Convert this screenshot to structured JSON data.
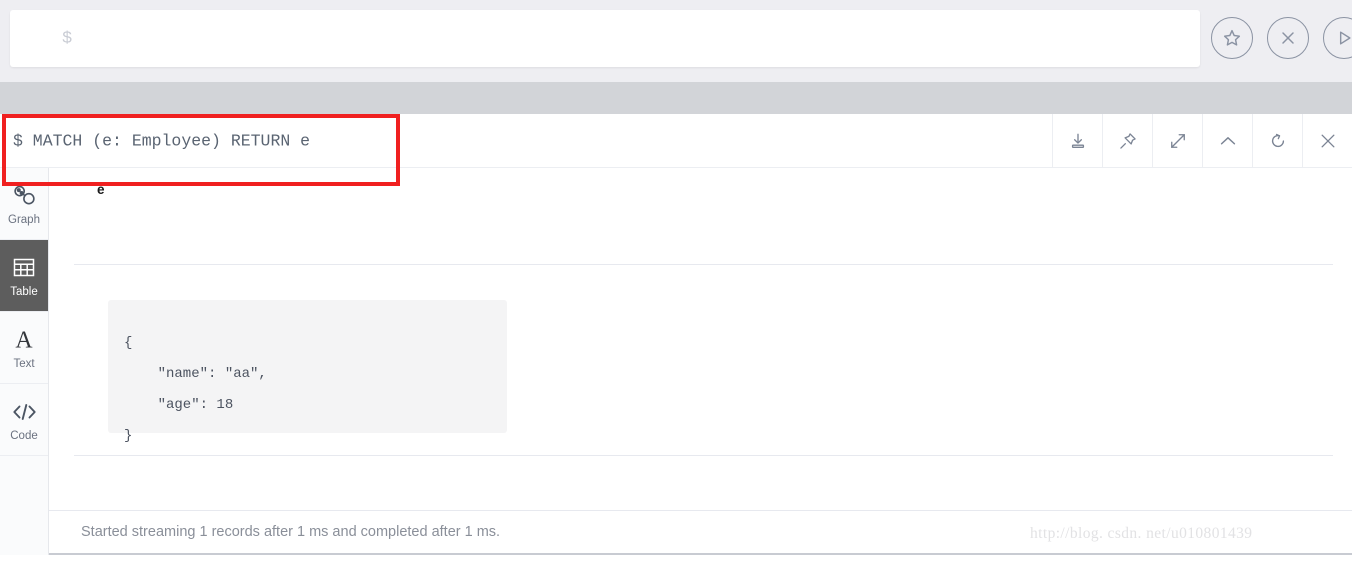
{
  "editor": {
    "placeholder": "$",
    "value": "",
    "buttons": [
      {
        "name": "favorite-button",
        "icon": "star-circle-icon",
        "label": "Favorite"
      },
      {
        "name": "clear-button",
        "icon": "close-circle-icon",
        "label": "Clear"
      },
      {
        "name": "run-button",
        "icon": "play-circle-icon",
        "label": "Run"
      }
    ]
  },
  "query": {
    "prompt": "$",
    "text": "$ MATCH (e: Employee) RETURN e",
    "toolbar": [
      {
        "name": "download-button",
        "icon": "download-icon",
        "label": "Download"
      },
      {
        "name": "pin-button",
        "icon": "pin-icon",
        "label": "Pin"
      },
      {
        "name": "expand-button",
        "icon": "expand-icon",
        "label": "Expand"
      },
      {
        "name": "collapse-button",
        "icon": "chevron-up-icon",
        "label": "Collapse"
      },
      {
        "name": "refresh-button",
        "icon": "refresh-icon",
        "label": "Refresh"
      },
      {
        "name": "close-button",
        "icon": "close-icon",
        "label": "Close"
      }
    ]
  },
  "sidebar": {
    "items": [
      {
        "label": "Graph",
        "icon": "graph-icon",
        "active": false
      },
      {
        "label": "Table",
        "icon": "table-icon",
        "active": true
      },
      {
        "label": "Text",
        "icon": "text-icon",
        "active": false
      },
      {
        "label": "Code",
        "icon": "code-icon",
        "active": false
      }
    ]
  },
  "results": {
    "column_header": "e",
    "rows": [
      {
        "json": "{\n    \"name\": \"aa\",\n    \"age\": 18\n}",
        "fields": {
          "name": "aa",
          "age": 18
        }
      }
    ]
  },
  "status": {
    "text": "Started streaming 1 records after 1 ms and completed after 1 ms."
  },
  "watermark": {
    "text": "http://blog. csdn. net/u010801439"
  },
  "annotation": {
    "color": "#f02020"
  }
}
